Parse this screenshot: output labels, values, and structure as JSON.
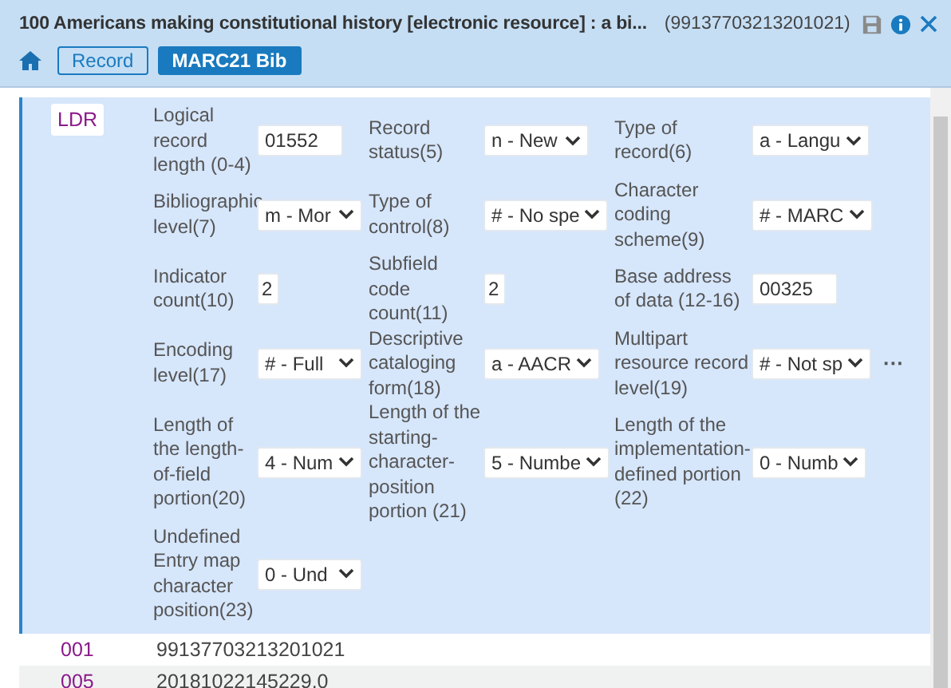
{
  "header": {
    "title": "100 Americans making constitutional history [electronic resource] : a bi...",
    "record_id": "(99137703213201021)",
    "tabs": [
      {
        "label": "Record",
        "selected": false
      },
      {
        "label": "MARC21 Bib",
        "selected": true
      }
    ]
  },
  "leader": {
    "tag": "LDR",
    "rows": [
      {
        "fields": [
          {
            "kind": "input",
            "label": "Logical record length (0-4)",
            "value": "01552"
          },
          {
            "kind": "select",
            "label": "Record status(5)",
            "value": "n - New"
          },
          {
            "kind": "select",
            "label": "Type of record(6)",
            "value": "a - Langu"
          }
        ]
      },
      {
        "fields": [
          {
            "kind": "select",
            "label": "Bibliographic level(7)",
            "value": "m - Mor"
          },
          {
            "kind": "select",
            "label": "Type of control(8)",
            "value": "# - No spe"
          },
          {
            "kind": "select",
            "label": "Character coding scheme(9)",
            "value": "# - MARC"
          }
        ]
      },
      {
        "fields": [
          {
            "kind": "short",
            "label": "Indicator count(10)",
            "value": "2"
          },
          {
            "kind": "short",
            "label": "Subfield code count(11)",
            "value": "2"
          },
          {
            "kind": "input",
            "label": "Base address of data (12-16)",
            "value": "00325"
          }
        ]
      },
      {
        "fields": [
          {
            "kind": "select",
            "label": "Encoding level(17)",
            "value": "# - Full"
          },
          {
            "kind": "select",
            "label": "Descriptive cataloging form(18)",
            "value": "a - AACR"
          },
          {
            "kind": "select",
            "label": "Multipart resource record level(19)",
            "value": "# - Not sp"
          }
        ],
        "more": "···"
      },
      {
        "fields": [
          {
            "kind": "select",
            "label": "Length of the length-of-field portion(20)",
            "value": "4 - Num"
          },
          {
            "kind": "select",
            "label": "Length of the starting-character-position portion (21)",
            "value": "5 - Numbe"
          },
          {
            "kind": "select",
            "label": "Length of the implementation-defined portion (22)",
            "value": "0 - Numb"
          }
        ]
      },
      {
        "fields": [
          {
            "kind": "select",
            "label": "Undefined Entry map character position(23)",
            "value": "0 - Und"
          }
        ]
      }
    ]
  },
  "fields": [
    {
      "tag": "001",
      "value": "99137703213201021",
      "shaded": false
    },
    {
      "tag": "005",
      "value": "20181022145229.0",
      "shaded": true
    }
  ]
}
